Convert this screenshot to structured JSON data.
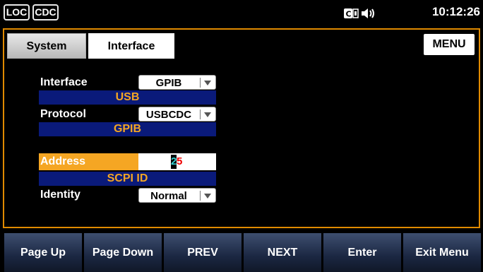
{
  "status": {
    "loc": "LOC",
    "cdc": "CDC",
    "time": "10:12:26"
  },
  "tabs": [
    "System",
    "Interface"
  ],
  "menu_label": "MENU",
  "form": {
    "interface_label": "Interface",
    "interface_value": "GPIB",
    "usb_header": "USB",
    "protocol_label": "Protocol",
    "protocol_value": "USBCDC",
    "gpib_header": "GPIB",
    "address_label": "Address",
    "address_digit1": "2",
    "address_digit2": "5",
    "scpi_header": "SCPI ID",
    "identity_label": "Identity",
    "identity_value": "Normal"
  },
  "softkeys": [
    "Page Up",
    "Page Down",
    "PREV",
    "NEXT",
    "Enter",
    "Exit Menu"
  ]
}
